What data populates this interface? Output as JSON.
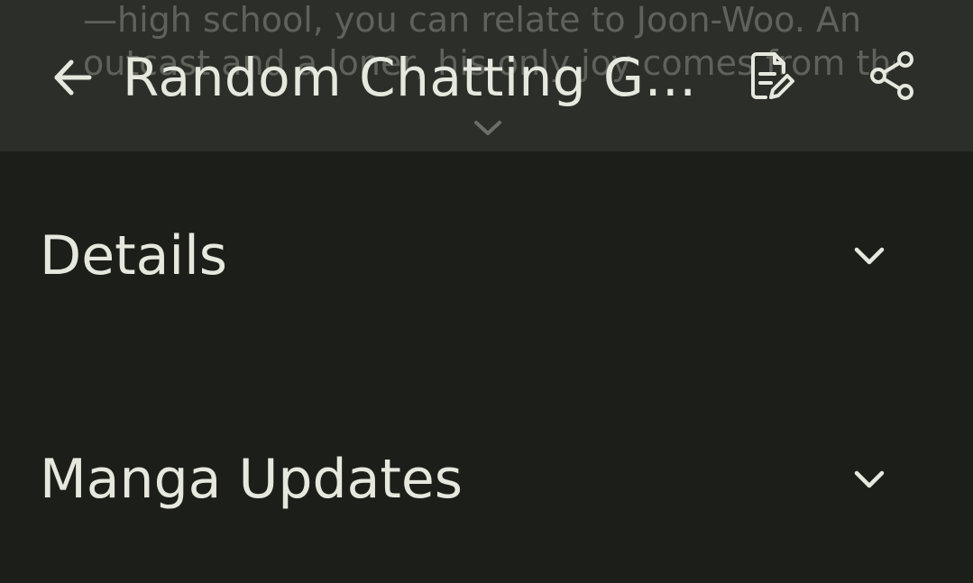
{
  "app_bar": {
    "title": "Random Chatting Geu...",
    "back_icon": "arrow-back-icon",
    "edit_icon": "edit-note-icon",
    "share_icon": "share-icon"
  },
  "description_preview": {
    "line1": "—high school, you can relate to Joon-Woo. An",
    "line2": "outcast and a loner, his only joy comes from the",
    "line3": "",
    "expand_icon": "expand-more-icon"
  },
  "sections": {
    "details": {
      "title": "Details",
      "icon": "chevron-down-icon"
    },
    "manga_updates": {
      "title": "Manga Updates",
      "icon": "chevron-down-icon"
    }
  },
  "colors": {
    "background": "#1c1e1a",
    "app_bar_background": "#2b2e29",
    "on_surface": "#e6e8de"
  }
}
